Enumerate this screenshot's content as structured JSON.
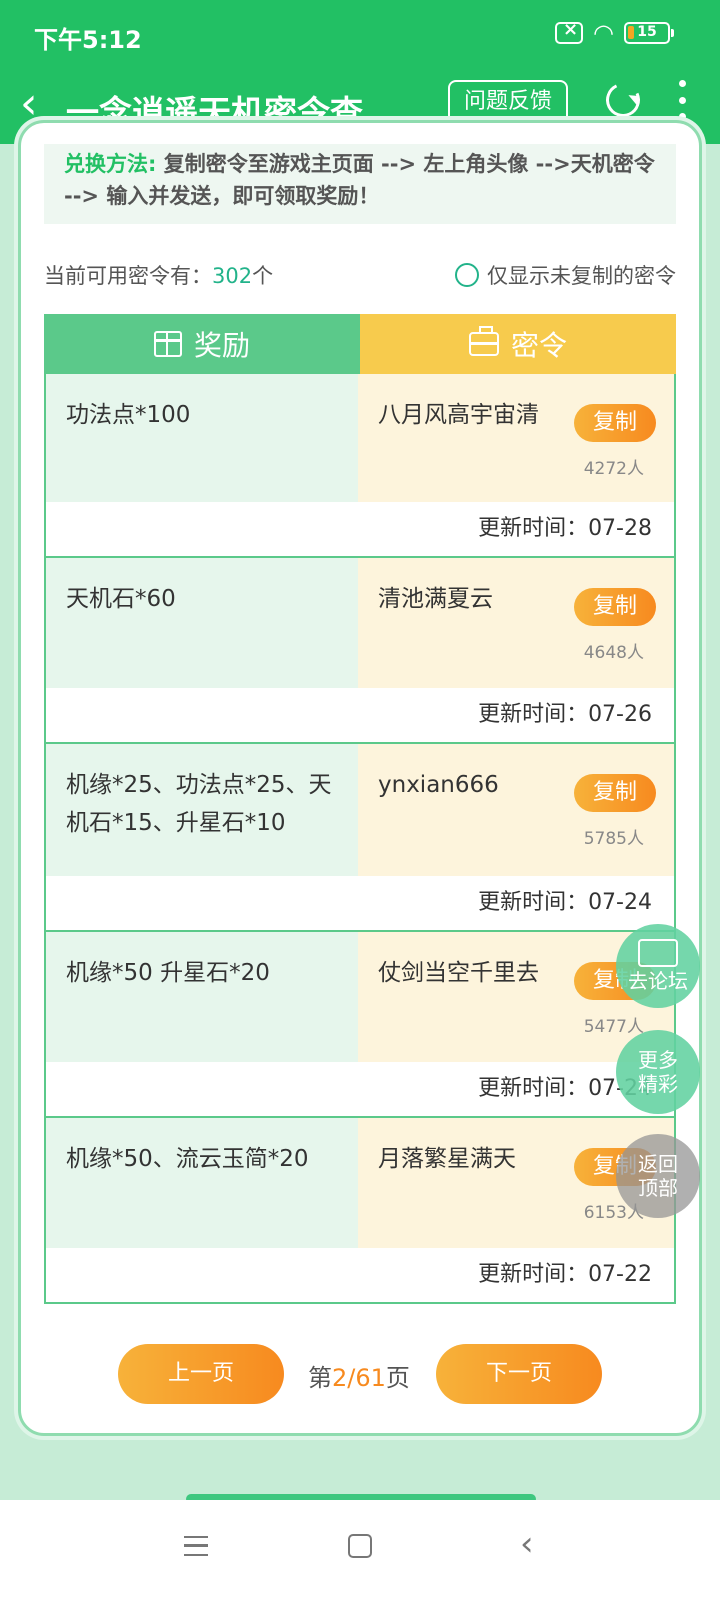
{
  "status": {
    "time": "下午5:12",
    "battery": "15",
    "wifi_icon": "wifi-icon",
    "sim_icon": "sim-error-icon"
  },
  "appbar": {
    "title": "一念逍遥天机密令查…",
    "feedback_label": "问题反馈"
  },
  "method": {
    "label": "兑换方法:",
    "text": "复制密令至游戏主页面 --> 左上角头像 -->天机密令 --> 输入并发送，即可领取奖励！"
  },
  "summary": {
    "prefix": "当前可用密令有：",
    "count": "302",
    "suffix": "个",
    "filter_label": "仅显示未复制的密令"
  },
  "table": {
    "reward_header": "奖励",
    "code_header": "密令",
    "rows": [
      {
        "reward": "功法点*100",
        "code": "八月风高宇宙清",
        "copy": "复制",
        "count": "4272人",
        "update": "更新时间：07-28"
      },
      {
        "reward": "天机石*60",
        "code": "清池满夏云",
        "copy": "复制",
        "count": "4648人",
        "update": "更新时间：07-26"
      },
      {
        "reward": "机缘*25、功法点*25、天机石*15、升星石*10",
        "code": "ynxian666",
        "copy": "复制",
        "count": "5785人",
        "update": "更新时间：07-24"
      },
      {
        "reward": "机缘*50 升星石*20",
        "code": "仗剑当空千里去",
        "copy": "复制",
        "count": "5477人",
        "update": "更新时间：07-24"
      },
      {
        "reward": "机缘*50、流云玉简*20",
        "code": "月落繁星满天",
        "copy": "复制",
        "count": "6153人",
        "update": "更新时间：07-22"
      }
    ]
  },
  "pager": {
    "prev": "上一页",
    "next": "下一页",
    "page_prefix": "第",
    "current": "2/61",
    "page_suffix": "页"
  },
  "floating": {
    "forum": "去论坛",
    "more": "更多精彩",
    "top": "返回顶部"
  },
  "colors": {
    "primary_green": "#22c064",
    "orange": "#f78a1f",
    "yellow_header": "#f7cb4d"
  }
}
